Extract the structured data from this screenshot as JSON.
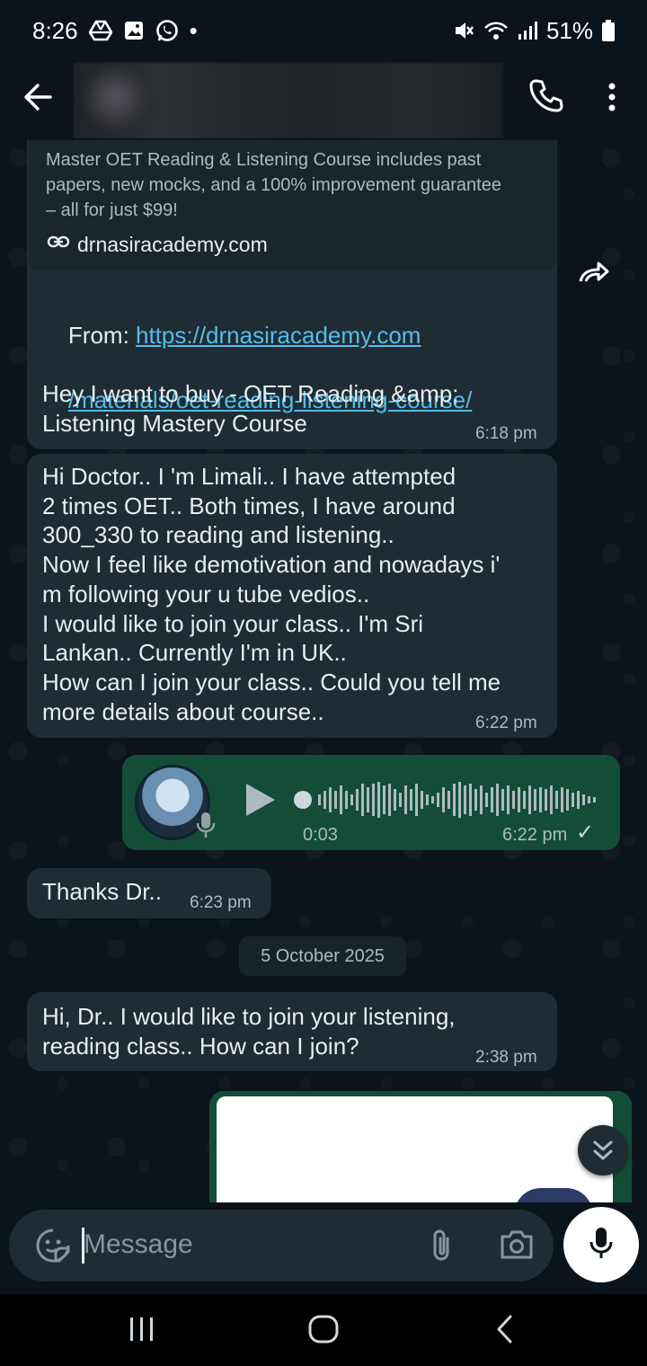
{
  "status_bar": {
    "time": "8:26",
    "battery": "51%",
    "dot": "•"
  },
  "header": {
    "back_icon": "arrow-left-icon",
    "call_icon": "phone-icon",
    "menu_icon": "more-vert-icon"
  },
  "messages": {
    "link_preview": {
      "description": "Master OET Reading & Listening Course includes past papers, new mocks, and a 100% improvement guarantee – all for just $99!",
      "domain": "drnasiracademy.com"
    },
    "first": {
      "from_label": "From: ",
      "url_line1": "https://drnasiracademy.com",
      "url_line2": "/materials/oet-reading-listening-course/",
      "body": "Hey I want to buy - OET Reading &amp;\nListening Mastery Course",
      "time": "6:18 pm"
    },
    "second": {
      "body": "Hi Doctor.. I 'm Limali.. I have attempted\n2 times OET.. Both times, I have around\n300_330 to reading and listening..\nNow I feel like demotivation and nowadays i'\nm following your u tube vedios..\nI would like to join your class.. I'm Sri\nLankan.. Currently I'm in UK..\nHow can I join your class.. Could you tell me\nmore details about course..",
      "time": "6:22 pm"
    },
    "voice": {
      "duration": "0:03",
      "time": "6:22 pm",
      "tick": "✓"
    },
    "third": {
      "body": "Thanks Dr..",
      "time": "6:23 pm"
    },
    "date_divider": "5 October 2025",
    "fourth": {
      "body": "Hi, Dr.. I would like to join your listening,\nreading class.. How can I join?",
      "time": "2:38 pm"
    }
  },
  "input": {
    "placeholder": "Message"
  },
  "colors": {
    "background": "#0b141a",
    "incoming_bubble": "#1f2c34",
    "outgoing_bubble": "#144d37",
    "link": "#53bdeb"
  }
}
